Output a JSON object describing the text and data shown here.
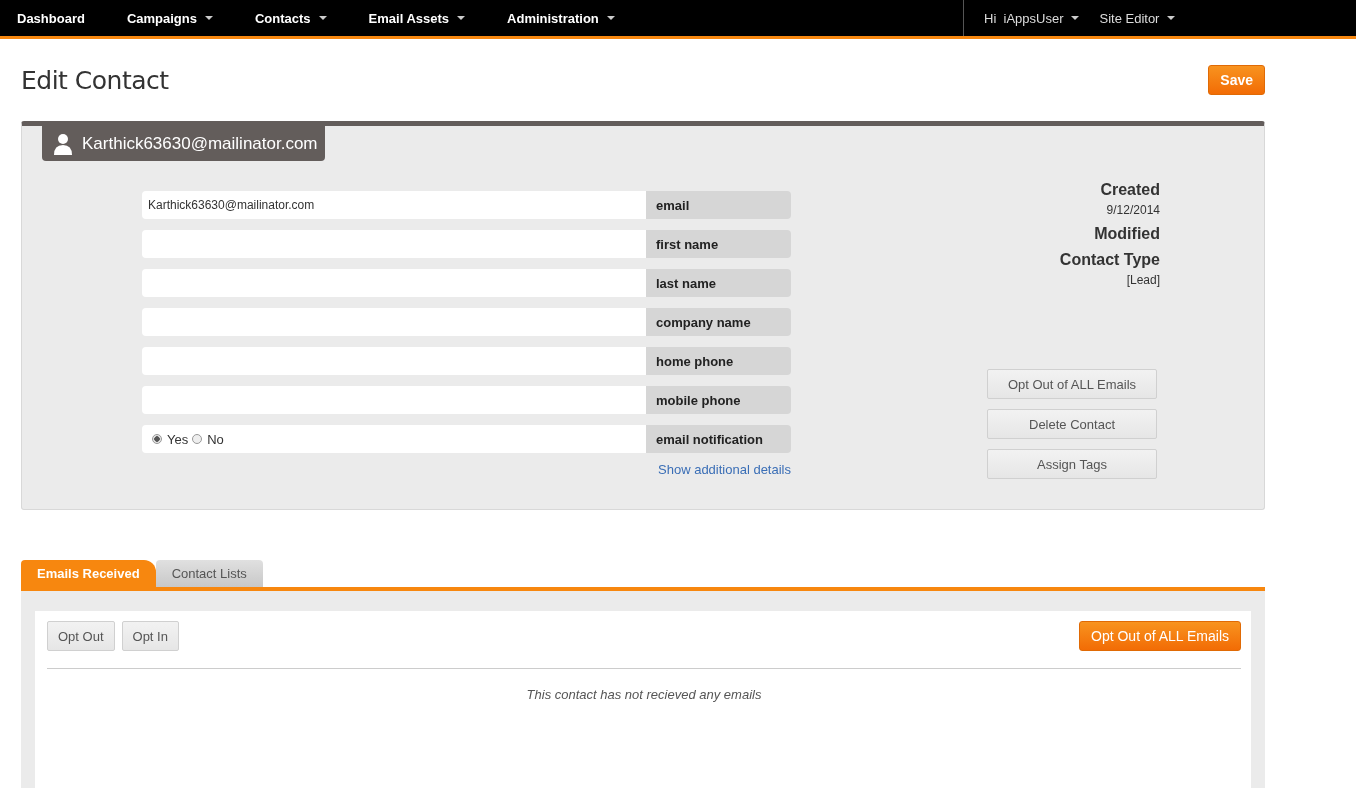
{
  "nav": {
    "items": [
      {
        "label": "Dashboard",
        "dropdown": false
      },
      {
        "label": "Campaigns",
        "dropdown": true
      },
      {
        "label": "Contacts",
        "dropdown": true
      },
      {
        "label": "Email Assets",
        "dropdown": true
      },
      {
        "label": "Administration",
        "dropdown": true
      }
    ],
    "user_items": [
      {
        "label": "Hi  iAppsUser",
        "dropdown": true
      },
      {
        "label": "Site Editor",
        "dropdown": true
      }
    ]
  },
  "page_title": "Edit Contact",
  "save_button": "Save",
  "contact_header": "Karthick63630@mailinator.com",
  "fields": [
    {
      "kind": "text",
      "label": "email",
      "value": "Karthick63630@mailinator.com"
    },
    {
      "kind": "text",
      "label": "first name"
    },
    {
      "kind": "text",
      "label": "last name"
    },
    {
      "kind": "text",
      "label": "company name"
    },
    {
      "kind": "text",
      "label": "home phone"
    },
    {
      "kind": "text",
      "label": "mobile phone"
    },
    {
      "kind": "radio",
      "label": "email notification",
      "options": [
        {
          "label": "Yes",
          "selected": true
        },
        {
          "label": "No",
          "selected": false
        }
      ]
    }
  ],
  "show_details_link": "Show additional details",
  "info": [
    {
      "label": "Created",
      "value": "9/12/2014"
    },
    {
      "label": "Modified"
    },
    {
      "label": "Contact Type",
      "value": "[Lead]"
    }
  ],
  "actions": [
    "Opt Out of ALL Emails",
    "Delete Contact",
    "Assign Tags"
  ],
  "tabs": [
    {
      "label": "Emails Received",
      "selected": true
    },
    {
      "label": "Contact Lists",
      "selected": false
    }
  ],
  "toolbar": {
    "buttons": [
      "Opt Out",
      "Opt In"
    ],
    "primary_button": "Opt Out of ALL Emails"
  },
  "empty_message": "This contact has not recieved any emails"
}
